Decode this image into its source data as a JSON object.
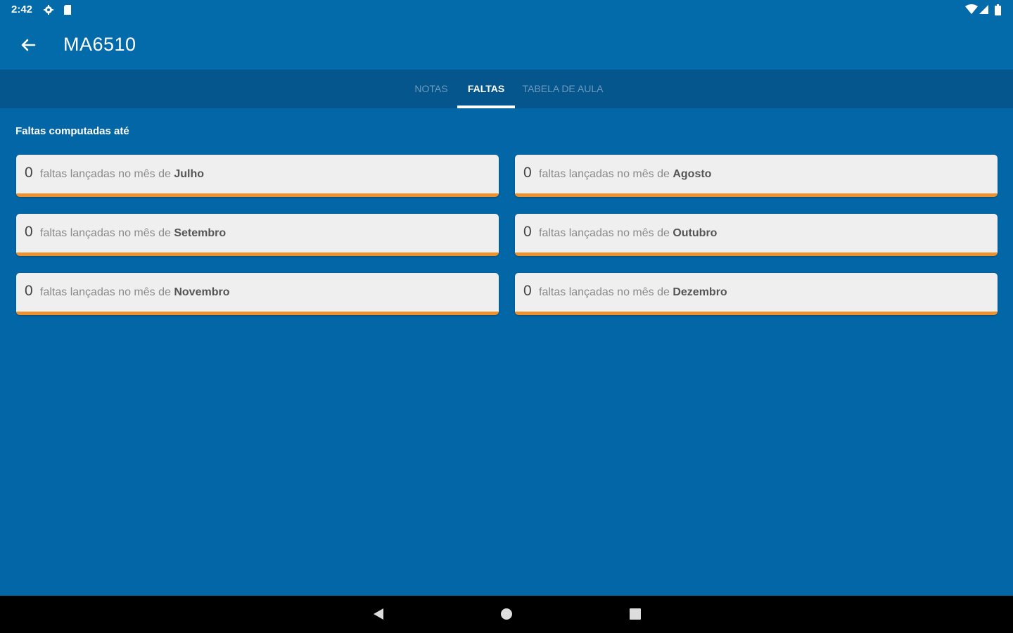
{
  "status_bar": {
    "time": "2:42",
    "icons": [
      "settings-icon",
      "sd-card-icon",
      "wifi-icon",
      "signal-icon",
      "battery-icon"
    ]
  },
  "app_bar": {
    "title": "MA6510",
    "back_icon": "arrow-back-icon"
  },
  "tabs": [
    {
      "label": "NOTAS",
      "active": false
    },
    {
      "label": "FALTAS",
      "active": true
    },
    {
      "label": "TABELA DE AULA",
      "active": false
    }
  ],
  "section_title": "Faltas computadas até",
  "cards": [
    {
      "count": "0",
      "text": "faltas lançadas no mês de",
      "month": "Julho"
    },
    {
      "count": "0",
      "text": "faltas lançadas no mês de",
      "month": "Agosto"
    },
    {
      "count": "0",
      "text": "faltas lançadas no mês de",
      "month": "Setembro"
    },
    {
      "count": "0",
      "text": "faltas lançadas no mês de",
      "month": "Outubro"
    },
    {
      "count": "0",
      "text": "faltas lançadas no mês de",
      "month": "Novembro"
    },
    {
      "count": "0",
      "text": "faltas lançadas no mês de",
      "month": "Dezembro"
    }
  ],
  "colors": {
    "background": "#0366a6",
    "app_bar": "#046bab",
    "tab_bar": "#04568c",
    "card": "#efefef",
    "accent": "#f0922b"
  },
  "nav_bar": {
    "icons": [
      "nav-back-icon",
      "nav-home-icon",
      "nav-recents-icon"
    ]
  }
}
